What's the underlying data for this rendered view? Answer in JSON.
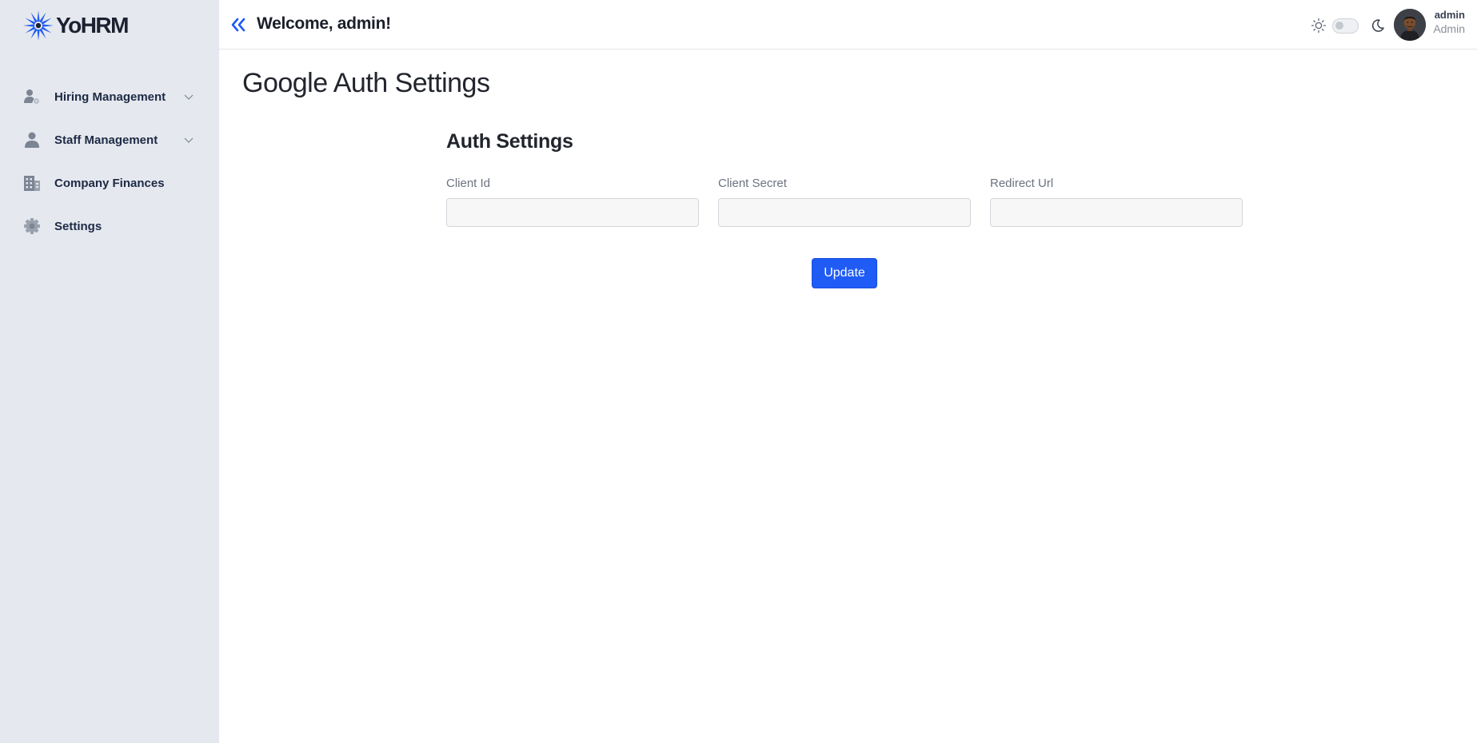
{
  "app": {
    "name": "YoHRM",
    "accent_color": "#1f5bf5",
    "sidebar_bg": "#e5e8ee"
  },
  "sidebar": {
    "items": [
      {
        "label": "Hiring Management",
        "icon": "hiring-icon",
        "expandable": true
      },
      {
        "label": "Staff Management",
        "icon": "staff-icon",
        "expandable": true
      },
      {
        "label": "Company Finances",
        "icon": "building-icon",
        "expandable": false
      },
      {
        "label": "Settings",
        "icon": "gear-icon",
        "expandable": false
      }
    ]
  },
  "header": {
    "welcome": "Welcome, admin!",
    "theme_toggle_on": false,
    "user": {
      "name": "admin",
      "role": "Admin"
    }
  },
  "main": {
    "title": "Google Auth Settings",
    "section_title": "Auth Settings",
    "fields": [
      {
        "label": "Client Id",
        "value": "",
        "placeholder": ""
      },
      {
        "label": "Client Secret",
        "value": "",
        "placeholder": ""
      },
      {
        "label": "Redirect Url",
        "value": "",
        "placeholder": ""
      }
    ],
    "submit_label": "Update"
  }
}
